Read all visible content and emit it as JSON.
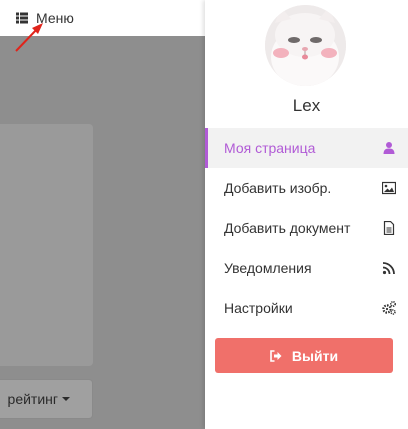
{
  "topbar": {
    "menu_label": "Меню"
  },
  "background": {
    "rating_label": "рейтинг"
  },
  "panel": {
    "username": "Lex",
    "nav_items": [
      {
        "label": "Моя страница",
        "icon": "user-icon",
        "active": true
      },
      {
        "label": "Добавить изобр.",
        "icon": "image-icon",
        "active": false
      },
      {
        "label": "Добавить документ",
        "icon": "document-icon",
        "active": false
      },
      {
        "label": "Уведомления",
        "icon": "rss-icon",
        "active": false
      },
      {
        "label": "Настройки",
        "icon": "gears-icon",
        "active": false
      }
    ],
    "logout_label": "Выйти"
  },
  "colors": {
    "accent_purple": "#b15bd6",
    "logout_red": "#f0706a",
    "arrow_red": "#e0241b",
    "backdrop": "#8e8e8e"
  }
}
